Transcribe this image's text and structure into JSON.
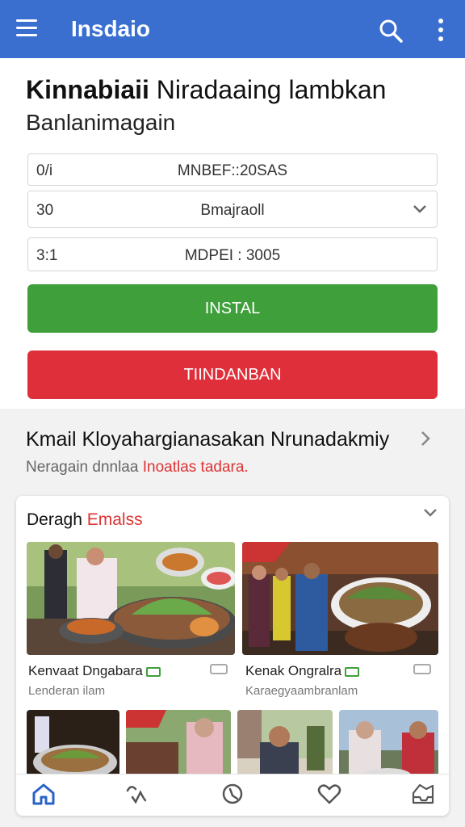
{
  "appbar": {
    "title": "Insdaio",
    "icons": [
      "menu-icon",
      "search-icon",
      "more-vert-icon"
    ]
  },
  "header": {
    "headline_bold": "Kinnabiaii",
    "headline_rest": " Niradaaing lambkan",
    "subhead": "Banlanimagain"
  },
  "fields": [
    {
      "num": "0/i",
      "value": "MNBEF::20SAS",
      "chevron": false
    },
    {
      "num": "30",
      "value": "Bmajraoll",
      "chevron": true
    },
    {
      "num": "3:1",
      "value": "MDPEI : 3005",
      "chevron": false
    }
  ],
  "buttons": {
    "primary": "INSTAL",
    "secondary": "TIINDANBAN"
  },
  "section": {
    "title": "Kmail Kloyahargianasakan Nrunadakmiy",
    "sub_plain": "Neragain dnnlaa ",
    "sub_red": "Inoatlas tadara."
  },
  "card": {
    "title_plain": "Deragh ",
    "title_red": "Emalss",
    "items": [
      {
        "title": "Kenvaat Dngabara",
        "sub": "Lenderan ilam"
      },
      {
        "title": "Kenak Ongralra",
        "sub": "Karaegyaambranlam"
      }
    ]
  },
  "colors": {
    "appbar": "#3a6fd0",
    "primary_button": "#3f9f3b",
    "secondary_button": "#df2f3a",
    "accent_red": "#d33333"
  },
  "bottom_nav": [
    "home-icon",
    "swap-icon",
    "discover-icon",
    "heart-icon",
    "inbox-icon"
  ]
}
